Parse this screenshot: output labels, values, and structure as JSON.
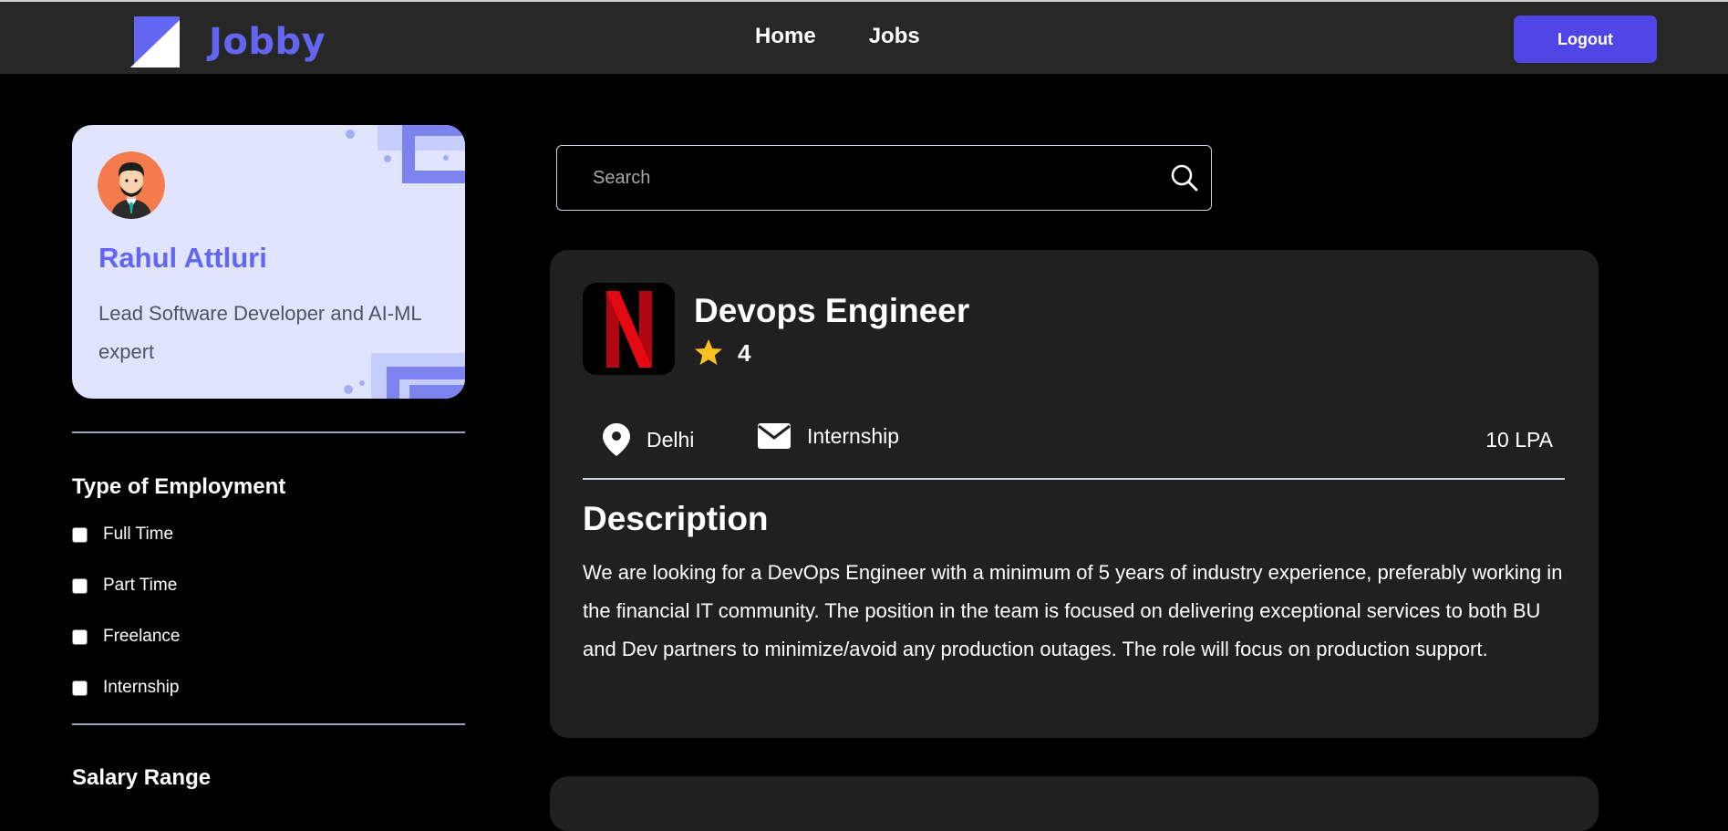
{
  "navbar": {
    "brand": "Jobby",
    "links": [
      {
        "label": "Home"
      },
      {
        "label": "Jobs"
      }
    ],
    "logout_label": "Logout"
  },
  "profile": {
    "name": "Rahul Attluri",
    "bio": "Lead Software Developer and AI-ML expert"
  },
  "filters": {
    "employment_heading": "Type of Employment",
    "employment_options": [
      {
        "label": "Full Time",
        "checked": false
      },
      {
        "label": "Part Time",
        "checked": false
      },
      {
        "label": "Freelance",
        "checked": false
      },
      {
        "label": "Internship",
        "checked": false
      }
    ],
    "salary_heading": "Salary Range"
  },
  "search": {
    "placeholder": "Search",
    "value": ""
  },
  "job": {
    "title": "Devops Engineer",
    "rating": "4",
    "location": "Delhi",
    "employment_type": "Internship",
    "package": "10 LPA",
    "description_heading": "Description",
    "description": "We are looking for a DevOps Engineer with a minimum of 5 years of industry experience, preferably working in the financial IT community. The position in the team is focused on delivering exceptional services to both BU and Dev partners to minimize/avoid any production outages. The role will focus on production support."
  },
  "colors": {
    "accent": "#6366f1",
    "button": "#4f46e5",
    "navbar_bg": "#272727",
    "card_bg": "#202020",
    "profile_bg": "#e0e4ff",
    "star": "#fbbf24",
    "netflix_red": "#e50914"
  },
  "icons": {
    "brand": "jobby-logo-icon",
    "search": "search-icon",
    "star": "star-icon",
    "location": "location-pin-icon",
    "employment": "envelope-icon",
    "company": "netflix-logo-icon"
  }
}
